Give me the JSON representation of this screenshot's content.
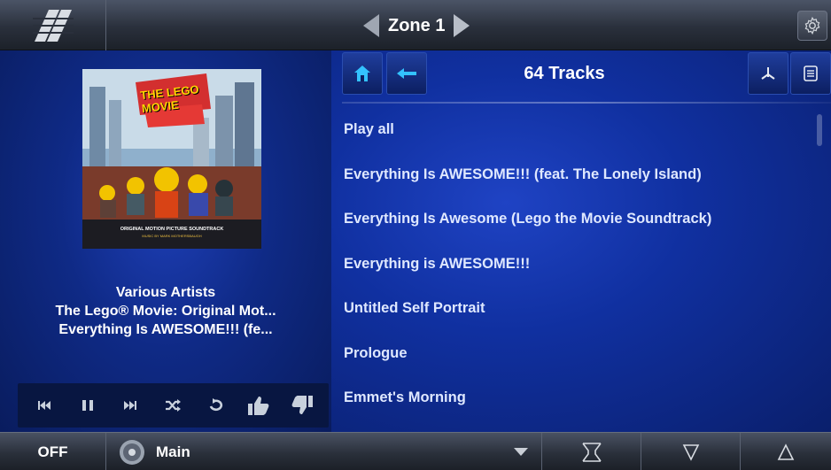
{
  "header": {
    "logo_icon": "brand-logo-icon",
    "zone_title": "Zone 1",
    "prev_icon": "triangle-left-icon",
    "next_icon": "triangle-right-icon",
    "settings_icon": "gear-icon"
  },
  "now_playing": {
    "artist": "Various Artists",
    "album": "The Lego® Movie: Original Mot...",
    "track": "Everything Is AWESOME!!! (fe...",
    "album_art": {
      "title_text": "THE LEGO MOVIE",
      "subtitle": "ORIGINAL MOTION PICTURE SOUNDTRACK",
      "credit": "MUSIC BY MARK MOTHERSBAUGH"
    }
  },
  "transport": [
    {
      "name": "previous-track-button",
      "icon": "skip-back-icon"
    },
    {
      "name": "pause-button",
      "icon": "pause-icon"
    },
    {
      "name": "next-track-button",
      "icon": "skip-forward-icon"
    },
    {
      "name": "shuffle-button",
      "icon": "shuffle-icon"
    },
    {
      "name": "repeat-button",
      "icon": "repeat-icon"
    },
    {
      "name": "thumbs-up-button",
      "icon": "thumbs-up-icon"
    },
    {
      "name": "thumbs-down-button",
      "icon": "thumbs-down-icon"
    }
  ],
  "browser": {
    "home_icon": "home-icon",
    "back_icon": "back-arrow-icon",
    "title": "64 Tracks",
    "sort_icon": "sort-icon",
    "queue_icon": "list-icon",
    "items": [
      "Play all",
      "Everything Is AWESOME!!! (feat. The Lonely Island)",
      "Everything Is Awesome (Lego the Movie Soundtrack)",
      "Everything is AWESOME!!!",
      "Untitled Self Portrait",
      "Prologue",
      "Emmet's Morning"
    ]
  },
  "footer": {
    "power_label": "OFF",
    "source_label": "Main",
    "source_icon": "speaker-icon",
    "mute_icon": "mute-icon",
    "volume_down_icon": "volume-down-icon",
    "volume_up_icon": "volume-up-icon"
  },
  "colors": {
    "panel_blue": "#1030a0",
    "bar_gray": "#2a303c",
    "home_icon_blue": "#33c2ff"
  }
}
